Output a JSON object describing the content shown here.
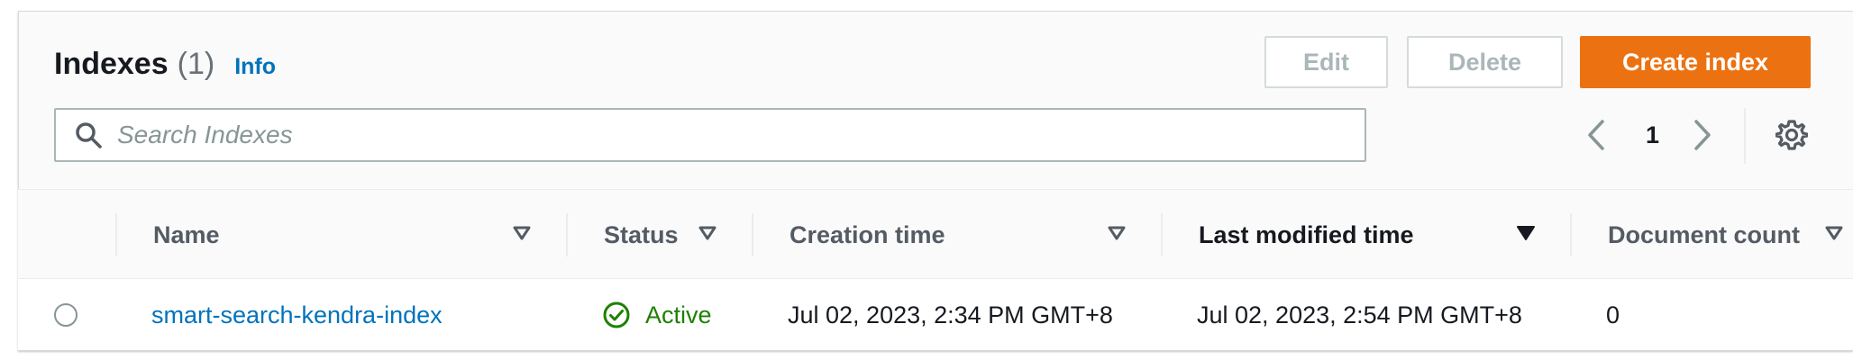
{
  "header": {
    "title": "Indexes",
    "count": "(1)",
    "info_label": "Info"
  },
  "actions": {
    "edit_label": "Edit",
    "delete_label": "Delete",
    "create_label": "Create index"
  },
  "search": {
    "placeholder": "Search Indexes",
    "value": ""
  },
  "pagination": {
    "current_page": "1"
  },
  "table": {
    "columns": [
      {
        "label": "Name"
      },
      {
        "label": "Status"
      },
      {
        "label": "Creation time"
      },
      {
        "label": "Last modified time"
      },
      {
        "label": "Document count"
      }
    ],
    "rows": [
      {
        "name": "smart-search-kendra-index",
        "status": "Active",
        "creation_time": "Jul 02, 2023, 2:34 PM GMT+8",
        "last_modified_time": "Jul 02, 2023, 2:54 PM GMT+8",
        "document_count": "0"
      }
    ]
  },
  "colors": {
    "primary": "#ec7211",
    "link": "#0073bb",
    "success": "#1d8102",
    "border": "#d5dbdb"
  },
  "icons": {
    "search": "search-icon",
    "prev": "chevron-left-icon",
    "next": "chevron-right-icon",
    "settings": "gear-icon",
    "sort": "caret-down-icon",
    "status": "check-circle-icon"
  }
}
